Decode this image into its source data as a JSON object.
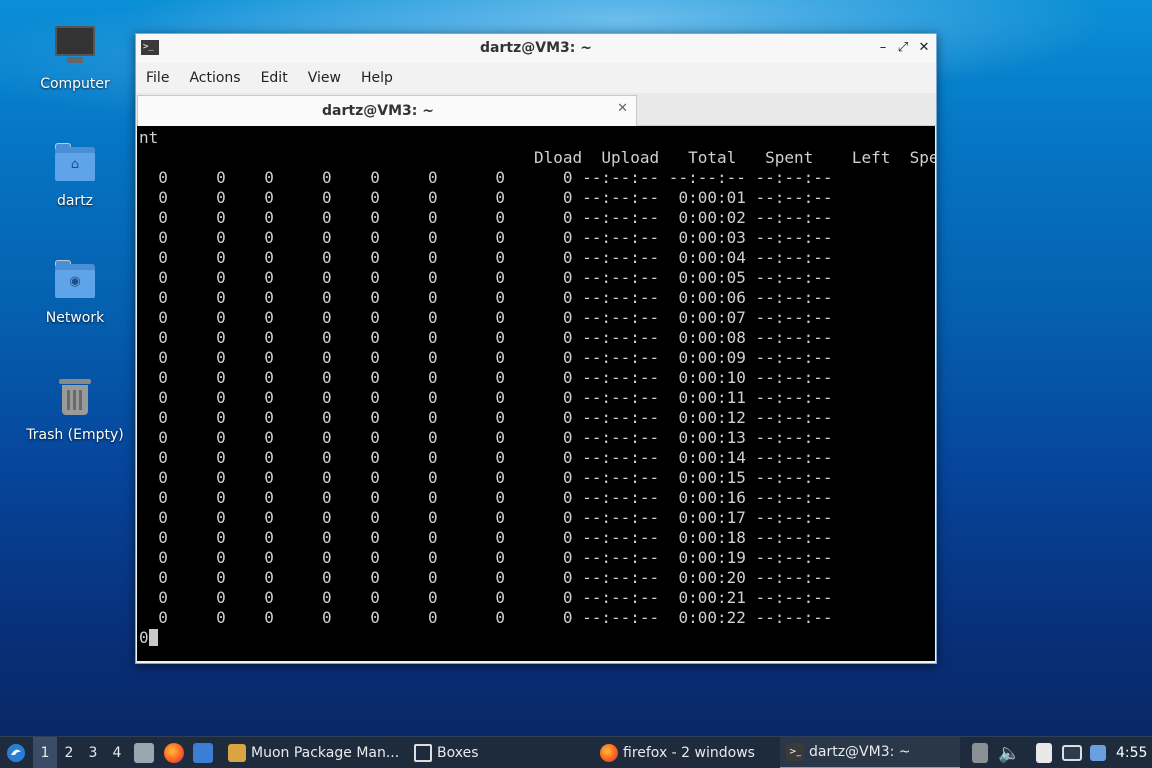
{
  "desktop": {
    "icons": [
      {
        "label": "Computer"
      },
      {
        "label": "dartz"
      },
      {
        "label": "Network"
      },
      {
        "label": "Trash (Empty)"
      }
    ]
  },
  "window": {
    "title": "dartz@VM3: ~",
    "menu": [
      "File",
      "Actions",
      "Edit",
      "View",
      "Help"
    ],
    "tab_label": "dartz@VM3: ~",
    "terminal_lines": [
      "nt",
      "                                         Dload  Upload   Total   Spent    Left  Speed",
      "  0     0    0     0    0     0      0      0 --:--:-- --:--:-- --:--:--",
      "  0     0    0     0    0     0      0      0 --:--:--  0:00:01 --:--:--",
      "  0     0    0     0    0     0      0      0 --:--:--  0:00:02 --:--:--",
      "  0     0    0     0    0     0      0      0 --:--:--  0:00:03 --:--:--",
      "  0     0    0     0    0     0      0      0 --:--:--  0:00:04 --:--:--",
      "  0     0    0     0    0     0      0      0 --:--:--  0:00:05 --:--:--",
      "  0     0    0     0    0     0      0      0 --:--:--  0:00:06 --:--:--",
      "  0     0    0     0    0     0      0      0 --:--:--  0:00:07 --:--:--",
      "  0     0    0     0    0     0      0      0 --:--:--  0:00:08 --:--:--",
      "  0     0    0     0    0     0      0      0 --:--:--  0:00:09 --:--:--",
      "  0     0    0     0    0     0      0      0 --:--:--  0:00:10 --:--:--",
      "  0     0    0     0    0     0      0      0 --:--:--  0:00:11 --:--:--",
      "  0     0    0     0    0     0      0      0 --:--:--  0:00:12 --:--:--",
      "  0     0    0     0    0     0      0      0 --:--:--  0:00:13 --:--:--",
      "  0     0    0     0    0     0      0      0 --:--:--  0:00:14 --:--:--",
      "  0     0    0     0    0     0      0      0 --:--:--  0:00:15 --:--:--",
      "  0     0    0     0    0     0      0      0 --:--:--  0:00:16 --:--:--",
      "  0     0    0     0    0     0      0      0 --:--:--  0:00:17 --:--:--",
      "  0     0    0     0    0     0      0      0 --:--:--  0:00:18 --:--:--",
      "  0     0    0     0    0     0      0      0 --:--:--  0:00:19 --:--:--",
      "  0     0    0     0    0     0      0      0 --:--:--  0:00:20 --:--:--",
      "  0     0    0     0    0     0      0      0 --:--:--  0:00:21 --:--:--",
      "  0     0    0     0    0     0      0      0 --:--:--  0:00:22 --:--:--"
    ],
    "prompt_line": "0"
  },
  "taskbar": {
    "workspaces": [
      "1",
      "2",
      "3",
      "4"
    ],
    "tasks": [
      {
        "label": "Muon Package Man..."
      },
      {
        "label": "Boxes"
      },
      {
        "label": "firefox - 2 windows"
      },
      {
        "label": "dartz@VM3: ~"
      }
    ],
    "clock": "4:55"
  },
  "colors": {
    "taskbar_bg": "#1d2b3d",
    "terminal_bg": "#000000",
    "terminal_fg": "#d0d0d0",
    "accent": "#6ea4e0"
  }
}
